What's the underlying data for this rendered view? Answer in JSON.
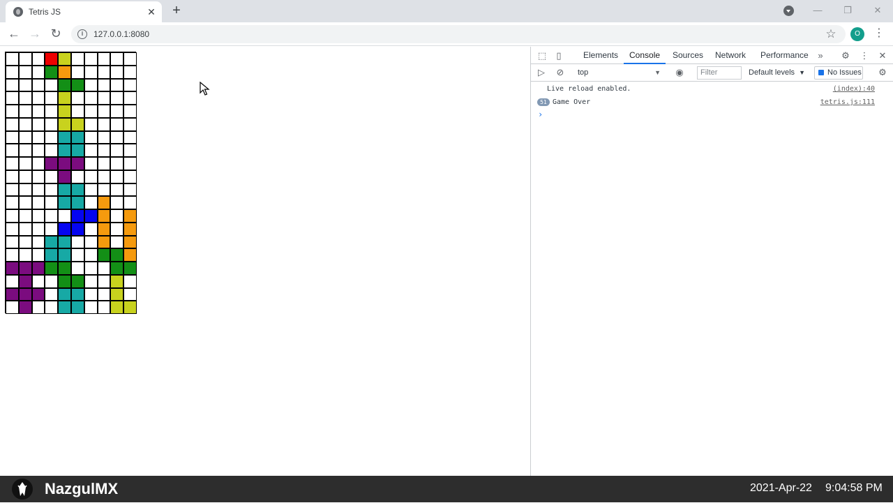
{
  "browser": {
    "tab_title": "Tetris JS",
    "url": "127.0.0.1:8080"
  },
  "devtools": {
    "tabs": [
      "Elements",
      "Console",
      "Sources",
      "Network",
      "Performance"
    ],
    "active_tab": "Console",
    "context": "top",
    "filter_placeholder": "Filter",
    "levels": "Default levels",
    "issues": "No Issues",
    "logs": [
      {
        "count": "",
        "message": "Live reload enabled.",
        "source": "(index):40"
      },
      {
        "count": "51",
        "message": "Game Over",
        "source": "tetris.js:111"
      }
    ],
    "prompt": "›"
  },
  "overlay": {
    "channel": "NazgulMX",
    "date": "2021-Apr-22",
    "time": "9:04:58 PM"
  },
  "board": {
    "columns": 10,
    "rows": 20,
    "colors": {
      "R": "#ee0000",
      "Y": "#c8d21e",
      "O": "#f59a0e",
      "G": "#138f16",
      "C": "#17a9a5",
      "P": "#7b0c7f",
      "B": "#0505f0",
      ".": "#ffffff"
    },
    "grid": [
      "...RY.....",
      "...GO.....",
      "....GG....",
      "....Y.....",
      "....Y.....",
      "....YY....",
      "....CC....",
      "....CC....",
      "...PPP....",
      "....P.....",
      "....CC....",
      "....CC.O..",
      ".....BBO.O",
      "....BB.O.O",
      "...CC..O.O",
      "...CC..GGO",
      "PPPGG...GG",
      ".P..GG..Y.",
      "PPP.CC..Y.",
      ".P..CC..YY"
    ]
  }
}
